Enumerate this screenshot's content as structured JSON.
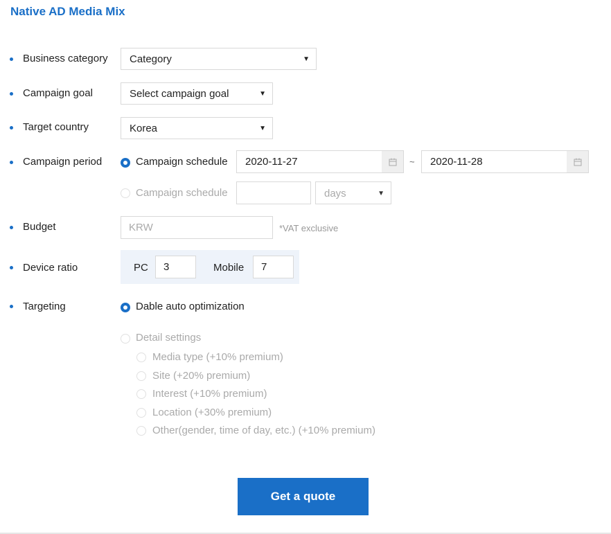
{
  "page": {
    "title": "Native AD Media Mix"
  },
  "form": {
    "business_category": {
      "label": "Business category",
      "value": "Category"
    },
    "campaign_goal": {
      "label": "Campaign goal",
      "value": "Select campaign goal"
    },
    "target_country": {
      "label": "Target country",
      "value": "Korea"
    },
    "campaign_period": {
      "label": "Campaign period",
      "option1": {
        "label": "Campaign schedule",
        "start": "2020-11-27",
        "separator": "~",
        "end": "2020-11-28"
      },
      "option2": {
        "label": "Campaign schedule",
        "days_value": "",
        "unit": "days"
      }
    },
    "budget": {
      "label": "Budget",
      "placeholder": "KRW",
      "note": "*VAT exclusive"
    },
    "device_ratio": {
      "label": "Device ratio",
      "pc_label": "PC",
      "pc_value": "3",
      "mobile_label": "Mobile",
      "mobile_value": "7"
    },
    "targeting": {
      "label": "Targeting",
      "auto": "Dable auto optimization",
      "detail": "Detail settings",
      "options": [
        "Media type (+10% premium)",
        "Site (+20% premium)",
        "Interest (+10% premium)",
        "Location (+30% premium)",
        "Other(gender, time of day, etc.) (+10% premium)"
      ]
    },
    "submit_label": "Get a quote"
  },
  "colors": {
    "accent": "#1a6fc7"
  },
  "icons": {
    "calendar": "calendar-icon",
    "dropdown": "caret-down-icon"
  }
}
